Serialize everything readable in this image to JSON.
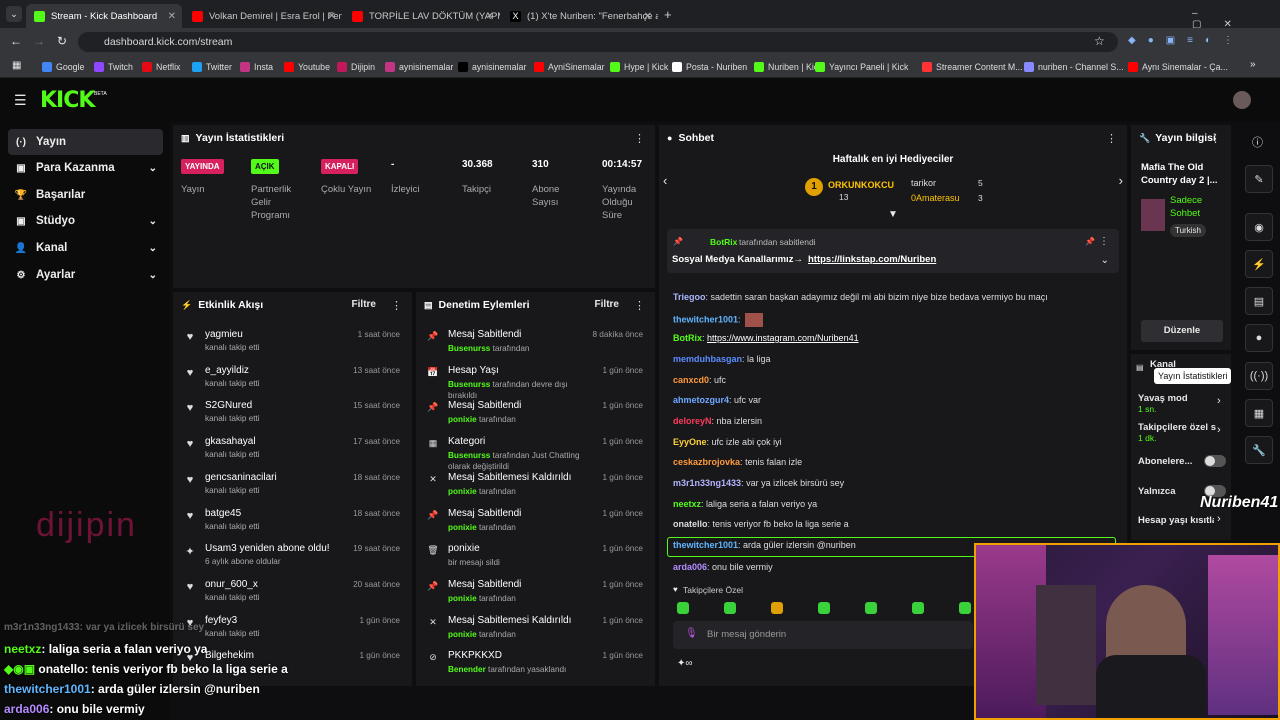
{
  "browser": {
    "tabs": [
      {
        "title": "Stream - Kick Dashboard",
        "color": "#53fc18"
      },
      {
        "title": "Volkan Demirel | Esra Erol | Fen",
        "color": "#ff0000"
      },
      {
        "title": "TORPİLE LAV DÖKTÜM (YAPMA",
        "color": "#ff0000"
      },
      {
        "title": "(1) X'te Nuriben: \"Fenerbahçe a",
        "color": "#ffffff"
      }
    ],
    "url": "dashboard.kick.com/stream",
    "bookmarks": [
      "Google",
      "Twitch",
      "Netflix",
      "Twitter",
      "Insta",
      "Youtube",
      "Dijipin",
      "aynisinemalar",
      "aynisinemalar",
      "AyniSinemalar",
      "Hype | Kick",
      "Posta - Nuriben",
      "Nuriben | Kick",
      "Yayıncı Paneli | Kick",
      "Streamer Content M...",
      "nuriben - Channel S...",
      "Aynı Sinemalar - Ça..."
    ]
  },
  "logo": "KICK",
  "logo_beta": "BETA",
  "nav": [
    {
      "label": "Yayın",
      "icon": "(·)"
    },
    {
      "label": "Para Kazanma",
      "icon": "▣"
    },
    {
      "label": "Başarılar",
      "icon": "🏆"
    },
    {
      "label": "Stüdyo",
      "icon": "▣"
    },
    {
      "label": "Kanal",
      "icon": "👤"
    },
    {
      "label": "Ayarlar",
      "icon": "⚙"
    }
  ],
  "stats": {
    "title": "Yayın İstatistikleri",
    "items": [
      {
        "value": "YAYINDA",
        "label": "Yayın",
        "badge": "#d6215e"
      },
      {
        "value": "AÇIK",
        "label": "Partnerlik Gelir Programı",
        "badge": "#53fc18"
      },
      {
        "value": "KAPALI",
        "label": "Çoklu Yayın",
        "badge": "#d6215e"
      },
      {
        "value": "-",
        "label": "İzleyici"
      },
      {
        "value": "30.368",
        "label": "Takipçi"
      },
      {
        "value": "310",
        "label": "Abone Sayısı"
      },
      {
        "value": "00:14:57",
        "label": "Yayında Olduğu Süre"
      }
    ]
  },
  "activity": {
    "title": "Etkinlik Akışı",
    "filter": "Filtre",
    "rows": [
      {
        "name": "yagmieu",
        "sub": "kanalı takip etti",
        "time": "1 saat önce"
      },
      {
        "name": "e_ayyildiz",
        "sub": "kanalı takip etti",
        "time": "13 saat önce"
      },
      {
        "name": "S2GNured",
        "sub": "kanalı takip etti",
        "time": "15 saat önce"
      },
      {
        "name": "gkasahayal",
        "sub": "kanalı takip etti",
        "time": "17 saat önce"
      },
      {
        "name": "gencsaninacilari",
        "sub": "kanalı takip etti",
        "time": "18 saat önce"
      },
      {
        "name": "batge45",
        "sub": "kanalı takip etti",
        "time": "18 saat önce"
      },
      {
        "name": "Usam3 yeniden abone oldu!",
        "sub": "6 aylık abone oldular",
        "time": "19 saat önce"
      },
      {
        "name": "onur_600_x",
        "sub": "kanalı takip etti",
        "time": "20 saat önce"
      },
      {
        "name": "feyfey3",
        "sub": "kanalı takip etti",
        "time": "1 gün önce"
      },
      {
        "name": "Bilgehekim",
        "sub": "",
        "time": "1 gün önce"
      }
    ]
  },
  "moderation": {
    "title": "Denetim Eylemleri",
    "filter": "Filtre",
    "rows": [
      {
        "name": "Mesaj Sabitlendi",
        "user": "Busenurss",
        "sub": " tarafından",
        "time": "8 dakika önce",
        "icon": "📌"
      },
      {
        "name": "Hesap Yaşı",
        "user": "Busenurss",
        "sub": " tarafından devre dışı bırakıldı",
        "time": "1 gün önce",
        "icon": "📅"
      },
      {
        "name": "Mesaj Sabitlendi",
        "user": "ponixie",
        "sub": " tarafından",
        "time": "1 gün önce",
        "icon": "📌"
      },
      {
        "name": "Kategori",
        "user": "Busenurss",
        "sub": " tarafından Just Chatting olarak değiştirildi",
        "time": "1 gün önce",
        "icon": "▦"
      },
      {
        "name": "Mesaj Sabitlemesi Kaldırıldı",
        "user": "ponixie",
        "sub": " tarafından",
        "time": "1 gün önce",
        "icon": "✕"
      },
      {
        "name": "Mesaj Sabitlendi",
        "user": "ponixie",
        "sub": " tarafından",
        "time": "1 gün önce",
        "icon": "📌"
      },
      {
        "name": "ponixie",
        "user": "",
        "sub": "bir mesajı sildi",
        "time": "1 gün önce",
        "icon": "🗑"
      },
      {
        "name": "Mesaj Sabitlendi",
        "user": "ponixie",
        "sub": " tarafından",
        "time": "1 gün önce",
        "icon": "📌"
      },
      {
        "name": "Mesaj Sabitlemesi Kaldırıldı",
        "user": "ponixie",
        "sub": " tarafından",
        "time": "1 gün önce",
        "icon": "✕"
      },
      {
        "name": "PKKPKKXD",
        "user": "Benender",
        "sub": " tarafından yasaklandı",
        "time": "1 gün önce",
        "icon": "⊘"
      }
    ]
  },
  "chat": {
    "title": "Sohbet",
    "gifters_title": "Haftalık en iyi Hediyeciler",
    "gifters": [
      {
        "name": "ORKUNKOKCU",
        "count": "13"
      },
      {
        "name": "tarikor",
        "count": "5"
      },
      {
        "name": "0Amaterasu",
        "count": "3"
      }
    ],
    "pinned_by": "BotRix",
    "pinned_suffix": " tarafından sabitlendi",
    "pinned_text": "Sosyal Medya Kanallarımız→ ",
    "pinned_link": "https://linkstap.com/Nuriben",
    "messages": [
      {
        "user": "Triegoo",
        "color": "#aab8ff",
        "text": "sadettin saran başkan adayımız değil mi abi bizim niye bize bedava vermiyo bu maçı"
      },
      {
        "user": "thewitcher1001",
        "color": "#5fb6ff",
        "text": ""
      },
      {
        "user": "BotRix",
        "color": "#53fc18",
        "text": "https://www.instagram.com/Nuriben41"
      },
      {
        "user": "memduhbasgan",
        "color": "#5a8cff",
        "text": "la liga"
      },
      {
        "user": "canxcd0",
        "color": "#ff9a3c",
        "text": "ufc"
      },
      {
        "user": "ahmetozgur4",
        "color": "#6fa8ff",
        "text": "ufc var"
      },
      {
        "user": "deloreyN",
        "color": "#ff3b5c",
        "text": "nba izlersin"
      },
      {
        "user": "EyyOne",
        "color": "#ffd23c",
        "text": "ufc izle abi çok iyi"
      },
      {
        "user": "ceskazbrojovka",
        "color": "#ff9a3c",
        "text": "tenis falan izle"
      },
      {
        "user": "m3r1n33ng1433",
        "color": "#b4b4ff",
        "text": "var ya izlicek birsürü sey"
      },
      {
        "user": "neetxz",
        "color": "#53fc18",
        "text": "laliga seria a falan veriyo ya"
      },
      {
        "user": "onatello",
        "color": "#dddddd",
        "text": "tenis veriyor fb beko la liga serie a"
      },
      {
        "user": "thewitcher1001",
        "color": "#5fb6ff",
        "text": "arda güler izlersin @nuriben"
      },
      {
        "user": "arda006",
        "color": "#b48cff",
        "text": "onu bile vermiy"
      }
    ],
    "follower_only": "Takipçilere Özel",
    "input_placeholder": "Bir mesaj gönderin"
  },
  "info": {
    "title": "Yayın bilgisi",
    "stream_title": "Mafia The Old Country day 2 |...",
    "category": "Sadece Sohbet",
    "tag": "Turkish",
    "edit": "Düzenle",
    "channel": "Kanal",
    "slow_label": "Yavaş mod",
    "slow_val": "1 sn.",
    "follow_label": "Takipçilere özel s",
    "follow_val": "1 dk.",
    "subs_label": "Abonelere...",
    "only_label": "Yalnızca",
    "age_label": "Hesap yaşı kısıtla"
  },
  "tooltip": "Yayın İstatistikleri",
  "overlay": {
    "brand": "dijipin",
    "cam_name": "Nuriben41",
    "chat": [
      {
        "user": "m3r1n33ng1433",
        "text": ": var ya izlicek birsürü sey"
      },
      {
        "user": "neetxz",
        "text": ": laliga seria a falan veriyo ya"
      },
      {
        "user": "onatello",
        "text": ": tenis veriyor fb beko la liga serie a"
      },
      {
        "user": "thewitcher1001",
        "text": ": arda güler izlersin @nuriben"
      },
      {
        "user": "arda006",
        "text": ": onu bile vermiy"
      }
    ]
  }
}
